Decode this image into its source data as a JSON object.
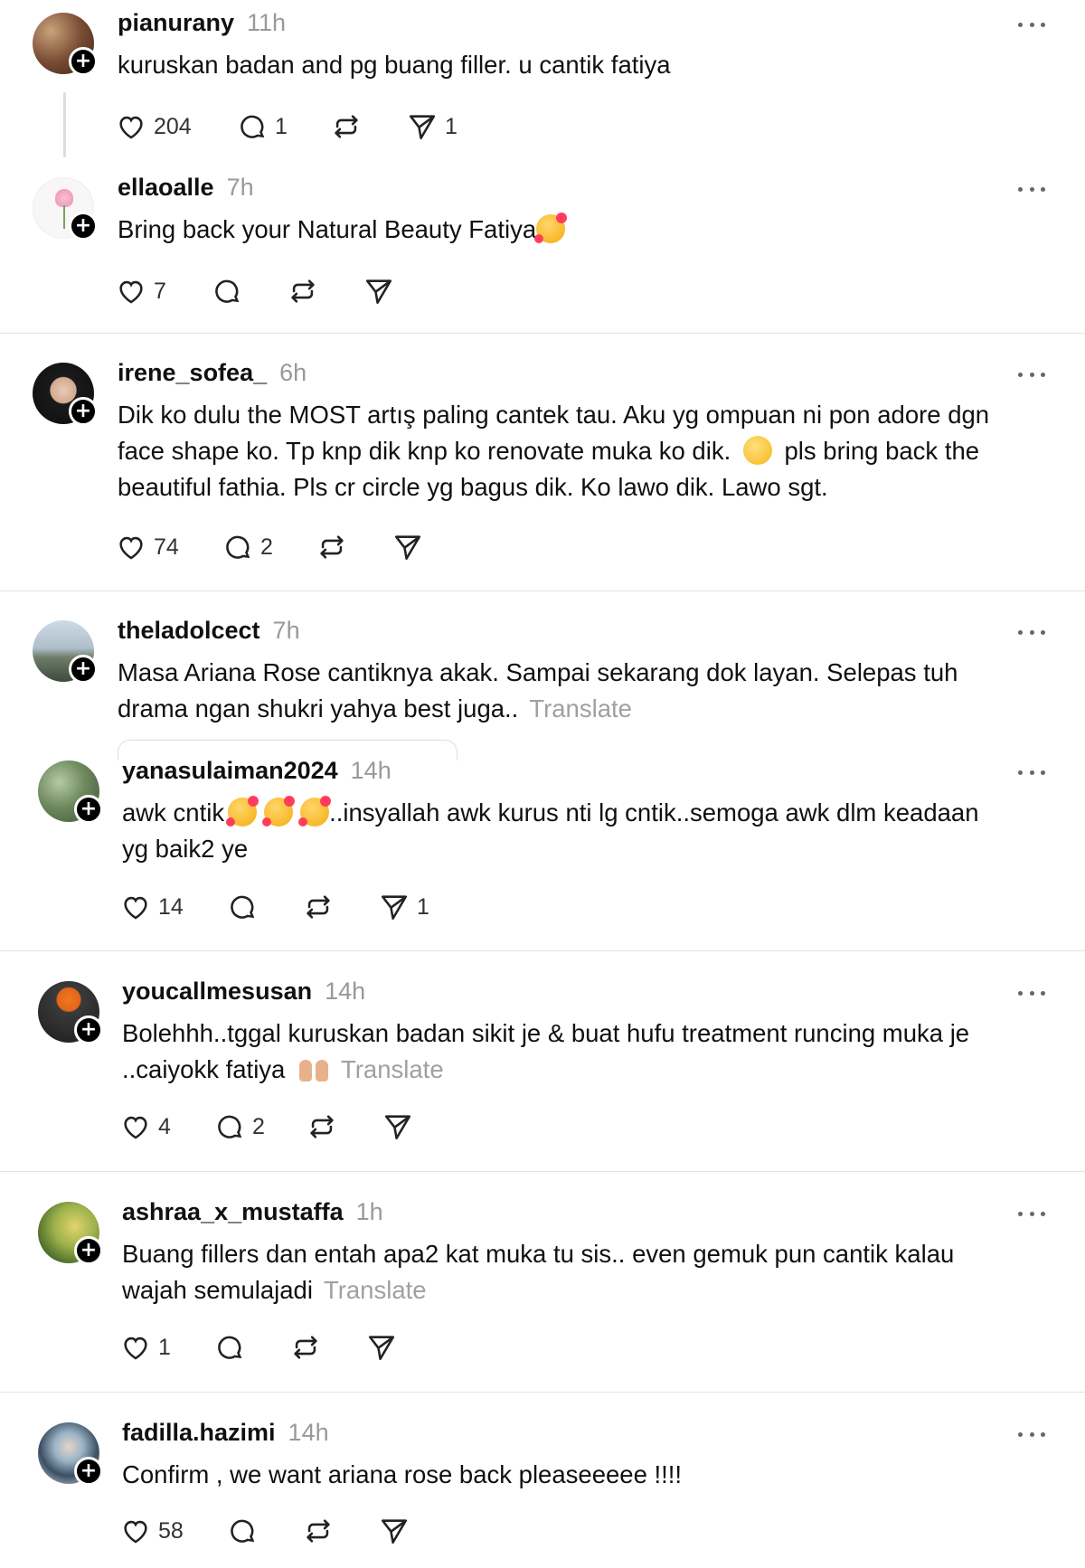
{
  "posts": [
    {
      "username": "pianurany",
      "time": "11h",
      "lines": [
        "kuruskan badan and pg buang filler. u cantik fatiya"
      ],
      "likes": "204",
      "replies": "1",
      "shares": "1"
    },
    {
      "username": "ellaoalle",
      "time": "7h",
      "lines": [
        "Bring back your Natural Beauty Fatiya"
      ],
      "likes": "7",
      "replies": "",
      "shares": ""
    },
    {
      "username": "irene_sofea_",
      "time": "6h",
      "lines": [
        "Dik ko dulu the MOST artış paling cantek tau. Aku yg ompuan ni pon adore dgn",
        "face shape ko. Tp knp dik knp ko renovate muka ko dik.",
        "pls bring back the",
        "beautiful fathia. Pls cr circle yg bagus dik. Ko lawo dik. Lawo sgt."
      ],
      "likes": "74",
      "replies": "2",
      "shares": ""
    },
    {
      "username": "theladolcect",
      "time": "7h",
      "lines": [
        "Masa Ariana Rose cantiknya akak. Sampai sekarang dok layan. Selepas tuh",
        "drama ngan shukri yahya best juga.."
      ],
      "translate": "Translate"
    },
    {
      "username": "yanasulaiman2024",
      "time": "14h",
      "lines": [
        "awk cntik",
        "..insyallah awk kurus nti lg cntik..semoga awk dlm keadaan",
        "yg baik2 ye"
      ],
      "likes": "14",
      "replies": "",
      "shares": "1"
    },
    {
      "username": "youcallmesusan",
      "time": "14h",
      "lines": [
        "Bolehhh..tggal kuruskan badan sikit je & buat hufu treatment runcing muka je",
        "..caiyokk fatiya"
      ],
      "translate": "Translate",
      "likes": "4",
      "replies": "2",
      "shares": ""
    },
    {
      "username": "ashraa_x_mustaffa",
      "time": "1h",
      "lines": [
        "Buang fillers dan entah apa2 kat muka tu sis.. even gemuk pun cantik kalau",
        "wajah semulajadi"
      ],
      "translate": "Translate",
      "likes": "1",
      "replies": "",
      "shares": ""
    },
    {
      "username": "fadilla.hazimi",
      "time": "14h",
      "lines": [
        "Confirm , we want ariana rose back pleaseeeee !!!!"
      ],
      "likes": "58",
      "replies": "",
      "shares": ""
    }
  ],
  "icons": {
    "like": "heart-icon",
    "reply": "comment-icon",
    "repost": "repost-icon",
    "share": "send-icon",
    "more": "more-icon",
    "follow": "plus-icon"
  },
  "colors": {
    "text": "#101010",
    "muted": "#999999",
    "divider": "#e2e2e2"
  }
}
